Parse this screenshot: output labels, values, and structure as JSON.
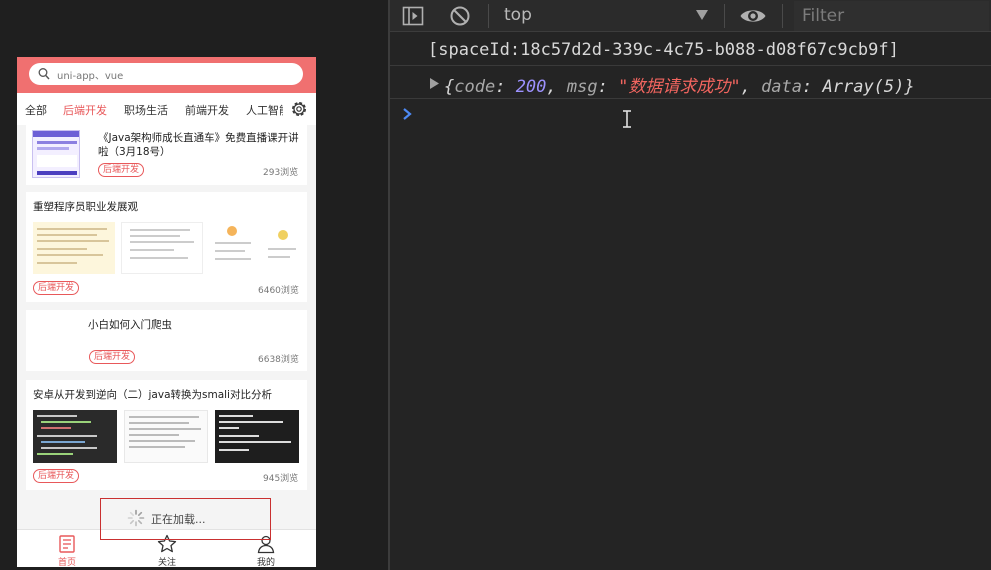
{
  "app": {
    "search_placeholder": "uni-app、vue",
    "tabs": [
      "全部",
      "后端开发",
      "职场生活",
      "前端开发",
      "人工智能"
    ],
    "active_tab_index": 1,
    "cards": [
      {
        "title": "《Java架构师成长直通车》免费直播课开讲啦（3月18号）",
        "tag": "后端开发",
        "views": "293浏览"
      },
      {
        "title": "重塑程序员职业发展观",
        "tag": "后端开发",
        "views": "6460浏览"
      },
      {
        "title": "小白如何入门爬虫",
        "tag": "后端开发",
        "views": "6638浏览"
      },
      {
        "title": "安卓从开发到逆向（二）java转换为smali对比分析",
        "tag": "后端开发",
        "views": "945浏览"
      }
    ],
    "loading_text": "正在加载...",
    "tabbar": [
      {
        "label": "首页",
        "icon": "home-icon"
      },
      {
        "label": "关注",
        "icon": "star-icon"
      },
      {
        "label": "我的",
        "icon": "user-icon"
      }
    ],
    "accent_color": "#e8585a"
  },
  "devtools": {
    "context": "top",
    "filter_placeholder": "Filter",
    "log_line": "[spaceId:18c57d2d-339c-4c75-b088-d08f67c9cb9f]",
    "object_preview": {
      "open": "{",
      "code_key": "code",
      "code_value": "200",
      "msg_key": "msg",
      "msg_value": "\"数据请求成功\"",
      "data_key": "data",
      "data_value": "Array(5)",
      "close": "}"
    }
  }
}
